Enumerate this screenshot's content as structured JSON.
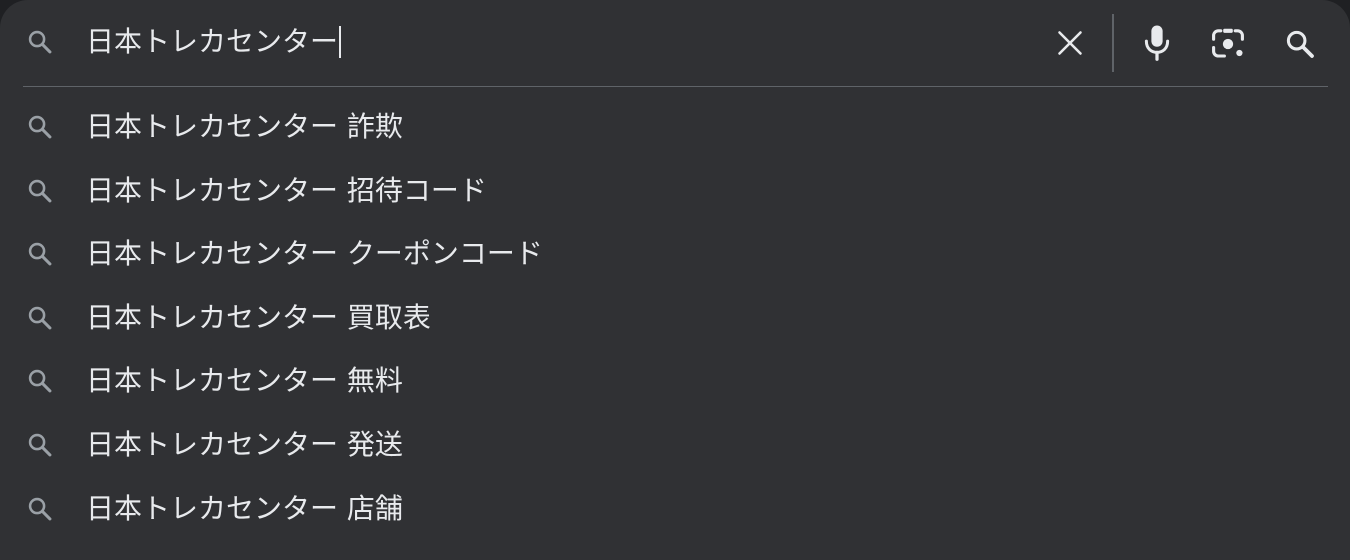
{
  "search": {
    "query": "日本トレカセンター",
    "icons": {
      "leading": "search-icon",
      "clear": "close-icon",
      "voice": "microphone-icon",
      "lens": "camera-lens-icon",
      "submit": "search-icon"
    }
  },
  "suggestions": [
    {
      "text": "日本トレカセンター 詐欺",
      "icon": "search-icon"
    },
    {
      "text": "日本トレカセンター 招待コード",
      "icon": "search-icon"
    },
    {
      "text": "日本トレカセンター クーポンコード",
      "icon": "search-icon"
    },
    {
      "text": "日本トレカセンター 買取表",
      "icon": "search-icon"
    },
    {
      "text": "日本トレカセンター 無料",
      "icon": "search-icon"
    },
    {
      "text": "日本トレカセンター 発送",
      "icon": "search-icon"
    },
    {
      "text": "日本トレカセンター 店舗",
      "icon": "search-icon"
    }
  ],
  "colors": {
    "background": "#303134",
    "text": "#e8eaed",
    "icon": "#9aa0a6",
    "icon_strong": "#e8eaed",
    "divider": "#5f6368"
  }
}
